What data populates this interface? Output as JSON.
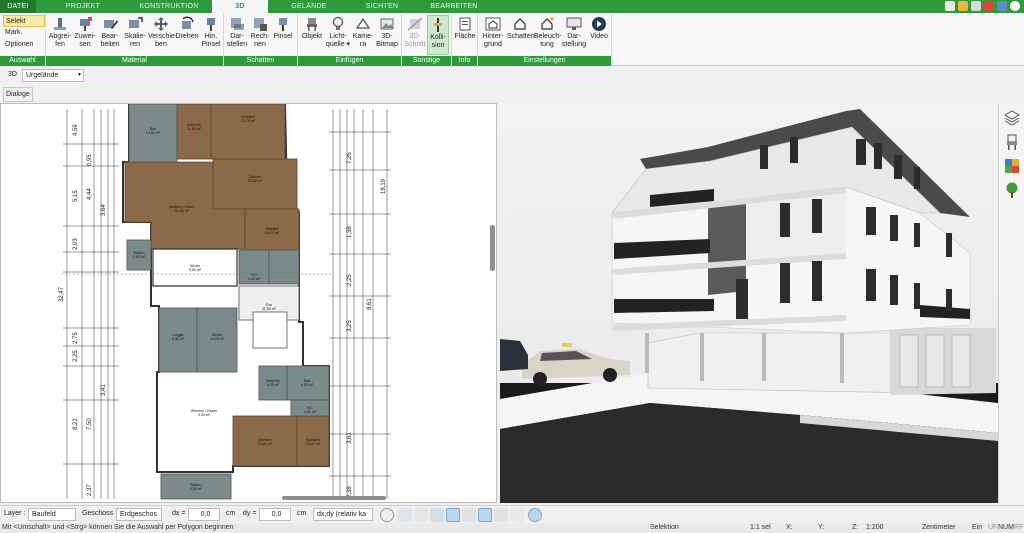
{
  "tabs": [
    {
      "label": "DATEI"
    },
    {
      "label": "PROJEKT"
    },
    {
      "label": "KONSTRUKTION"
    },
    {
      "label": "3D"
    },
    {
      "label": "GELÄNDE"
    },
    {
      "label": "SICHTEN"
    },
    {
      "label": "BEARBEITEN"
    }
  ],
  "ribbon": {
    "auswahl": {
      "label": "Auswahl",
      "items": [
        "Selekt",
        "Mark.",
        "Optionen"
      ]
    },
    "material": {
      "label": "Material",
      "buttons": [
        "Abgrei-\nfen",
        "Zuwei-\nsen",
        "Bear-\nbeiten",
        "Skalie-\nren",
        "Verschie-\nben",
        "Drehen",
        "Hin.\nPinsel"
      ]
    },
    "schatten": {
      "label": "Schatten",
      "buttons": [
        "Dar-\nstellen",
        "Rech-\nnen",
        "Pinsel"
      ]
    },
    "einfuegen": {
      "label": "Einfügen",
      "buttons": [
        "Objekt",
        "Licht-\nquelle ▾",
        "Kame-\nra",
        "3D-\nBitmap"
      ]
    },
    "sonstige": {
      "label": "Sonstige",
      "buttons": [
        "3D-\nSchnitt",
        "Kolli-\nsion"
      ]
    },
    "info": {
      "label": "Info",
      "buttons": [
        "Fläche"
      ]
    },
    "einstellungen": {
      "label": "Einstellungen",
      "buttons": [
        "Hinter-\ngrund",
        "Schatten",
        "Beleuch-\ntung",
        "Dar-\nstellung",
        "Video"
      ]
    }
  },
  "toolbar": {
    "mode_label": "3D",
    "terrain_value": "Urgelände",
    "dialog_label": "Dialoge"
  },
  "plan": {
    "rooms": [
      {
        "name": "Bad",
        "area": "14,02 m²"
      },
      {
        "name": "Ankleide",
        "area": "11,88 m²"
      },
      {
        "name": "Schlafen",
        "area": "22,79 m²"
      },
      {
        "name": "Zimmer",
        "area": "22,03 m²"
      },
      {
        "name": "Wohnen / Essen",
        "area": "51,89 m²"
      },
      {
        "name": "Arbeiten",
        "area": "14,23 m²"
      },
      {
        "name": "Balkon",
        "area": "2,95 m²"
      },
      {
        "name": "Küche",
        "area": "0,00 m²"
      },
      {
        "name": "WC",
        "area": "2,43 m²"
      },
      {
        "name": "Flur",
        "area": "11,90 m²"
      },
      {
        "name": "Loggia",
        "area": "6,36 m²"
      },
      {
        "name": "Küche",
        "area": "14,28 m²"
      },
      {
        "name": "Wohnen / Essen",
        "area": "0,00 m²"
      },
      {
        "name": "Ankleide",
        "area": "4,35 m²"
      },
      {
        "name": "Bad",
        "area": "9,25 m²"
      },
      {
        "name": "WC",
        "area": "2,61 m²"
      },
      {
        "name": "Arbeiten",
        "area": "10,82 m²"
      },
      {
        "name": "Schlafen",
        "area": "10,07 m²"
      },
      {
        "name": "Balkon",
        "area": "5,59 m²"
      }
    ],
    "left_dims": [
      "4,59",
      "5,15",
      "2,03",
      "32,47",
      "2,75",
      "2,25",
      "3,41",
      "7,50",
      "8,22",
      "2,37",
      "0,95",
      "4,44",
      "3,64"
    ],
    "right_dims": [
      "18,19",
      "7,26",
      "1,38",
      "2,25",
      "3,25",
      "3,61",
      "2,38",
      "8,61"
    ]
  },
  "bottombar": {
    "layer_label": "Layer :",
    "layer_value": "Baufeld",
    "geschoss_label": "Geschoss :",
    "geschoss_value": "Erdgeschos",
    "dx_label": "dx =",
    "dx_value": "0,0",
    "dx_unit": "cm",
    "dy_label": "dy =",
    "dy_value": "0,0",
    "dy_unit": "cm",
    "mode_value": "dx,dy (relativ ka"
  },
  "status": {
    "hint": "Mit <Umschalt> und <Strg> können Sie die Auswahl per Polygon beginnen",
    "selektion": "Selektion",
    "sel_count": "1:1 sel",
    "x": "X:",
    "y": "Y:",
    "z": "Z:",
    "scale": "1:200",
    "unit": "Zentimeter",
    "ein": "Ein",
    "uf": "UF",
    "num": "NUM",
    "rf": "RF"
  },
  "colors": {
    "accent": "#2e9a3c",
    "room_brown": "#8b6a4a",
    "room_grey": "#7d8a8a"
  }
}
